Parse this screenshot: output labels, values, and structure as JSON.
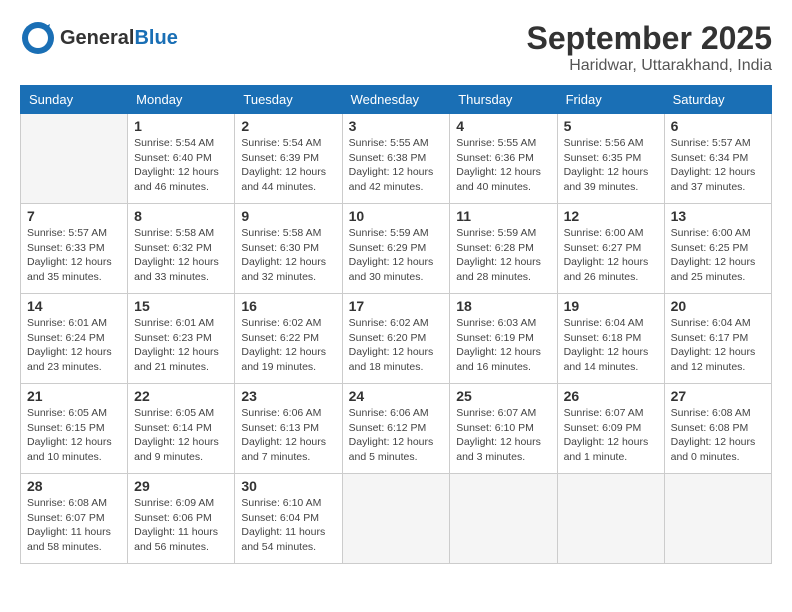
{
  "header": {
    "logo": {
      "general": "General",
      "blue": "Blue"
    },
    "title": "September 2025",
    "subtitle": "Haridwar, Uttarakhand, India"
  },
  "calendar": {
    "days_of_week": [
      "Sunday",
      "Monday",
      "Tuesday",
      "Wednesday",
      "Thursday",
      "Friday",
      "Saturday"
    ],
    "weeks": [
      [
        {
          "day": null,
          "info": null
        },
        {
          "day": "1",
          "info": "Sunrise: 5:54 AM\nSunset: 6:40 PM\nDaylight: 12 hours\nand 46 minutes."
        },
        {
          "day": "2",
          "info": "Sunrise: 5:54 AM\nSunset: 6:39 PM\nDaylight: 12 hours\nand 44 minutes."
        },
        {
          "day": "3",
          "info": "Sunrise: 5:55 AM\nSunset: 6:38 PM\nDaylight: 12 hours\nand 42 minutes."
        },
        {
          "day": "4",
          "info": "Sunrise: 5:55 AM\nSunset: 6:36 PM\nDaylight: 12 hours\nand 40 minutes."
        },
        {
          "day": "5",
          "info": "Sunrise: 5:56 AM\nSunset: 6:35 PM\nDaylight: 12 hours\nand 39 minutes."
        },
        {
          "day": "6",
          "info": "Sunrise: 5:57 AM\nSunset: 6:34 PM\nDaylight: 12 hours\nand 37 minutes."
        }
      ],
      [
        {
          "day": "7",
          "info": "Sunrise: 5:57 AM\nSunset: 6:33 PM\nDaylight: 12 hours\nand 35 minutes."
        },
        {
          "day": "8",
          "info": "Sunrise: 5:58 AM\nSunset: 6:32 PM\nDaylight: 12 hours\nand 33 minutes."
        },
        {
          "day": "9",
          "info": "Sunrise: 5:58 AM\nSunset: 6:30 PM\nDaylight: 12 hours\nand 32 minutes."
        },
        {
          "day": "10",
          "info": "Sunrise: 5:59 AM\nSunset: 6:29 PM\nDaylight: 12 hours\nand 30 minutes."
        },
        {
          "day": "11",
          "info": "Sunrise: 5:59 AM\nSunset: 6:28 PM\nDaylight: 12 hours\nand 28 minutes."
        },
        {
          "day": "12",
          "info": "Sunrise: 6:00 AM\nSunset: 6:27 PM\nDaylight: 12 hours\nand 26 minutes."
        },
        {
          "day": "13",
          "info": "Sunrise: 6:00 AM\nSunset: 6:25 PM\nDaylight: 12 hours\nand 25 minutes."
        }
      ],
      [
        {
          "day": "14",
          "info": "Sunrise: 6:01 AM\nSunset: 6:24 PM\nDaylight: 12 hours\nand 23 minutes."
        },
        {
          "day": "15",
          "info": "Sunrise: 6:01 AM\nSunset: 6:23 PM\nDaylight: 12 hours\nand 21 minutes."
        },
        {
          "day": "16",
          "info": "Sunrise: 6:02 AM\nSunset: 6:22 PM\nDaylight: 12 hours\nand 19 minutes."
        },
        {
          "day": "17",
          "info": "Sunrise: 6:02 AM\nSunset: 6:20 PM\nDaylight: 12 hours\nand 18 minutes."
        },
        {
          "day": "18",
          "info": "Sunrise: 6:03 AM\nSunset: 6:19 PM\nDaylight: 12 hours\nand 16 minutes."
        },
        {
          "day": "19",
          "info": "Sunrise: 6:04 AM\nSunset: 6:18 PM\nDaylight: 12 hours\nand 14 minutes."
        },
        {
          "day": "20",
          "info": "Sunrise: 6:04 AM\nSunset: 6:17 PM\nDaylight: 12 hours\nand 12 minutes."
        }
      ],
      [
        {
          "day": "21",
          "info": "Sunrise: 6:05 AM\nSunset: 6:15 PM\nDaylight: 12 hours\nand 10 minutes."
        },
        {
          "day": "22",
          "info": "Sunrise: 6:05 AM\nSunset: 6:14 PM\nDaylight: 12 hours\nand 9 minutes."
        },
        {
          "day": "23",
          "info": "Sunrise: 6:06 AM\nSunset: 6:13 PM\nDaylight: 12 hours\nand 7 minutes."
        },
        {
          "day": "24",
          "info": "Sunrise: 6:06 AM\nSunset: 6:12 PM\nDaylight: 12 hours\nand 5 minutes."
        },
        {
          "day": "25",
          "info": "Sunrise: 6:07 AM\nSunset: 6:10 PM\nDaylight: 12 hours\nand 3 minutes."
        },
        {
          "day": "26",
          "info": "Sunrise: 6:07 AM\nSunset: 6:09 PM\nDaylight: 12 hours\nand 1 minute."
        },
        {
          "day": "27",
          "info": "Sunrise: 6:08 AM\nSunset: 6:08 PM\nDaylight: 12 hours\nand 0 minutes."
        }
      ],
      [
        {
          "day": "28",
          "info": "Sunrise: 6:08 AM\nSunset: 6:07 PM\nDaylight: 11 hours\nand 58 minutes."
        },
        {
          "day": "29",
          "info": "Sunrise: 6:09 AM\nSunset: 6:06 PM\nDaylight: 11 hours\nand 56 minutes."
        },
        {
          "day": "30",
          "info": "Sunrise: 6:10 AM\nSunset: 6:04 PM\nDaylight: 11 hours\nand 54 minutes."
        },
        {
          "day": null,
          "info": null
        },
        {
          "day": null,
          "info": null
        },
        {
          "day": null,
          "info": null
        },
        {
          "day": null,
          "info": null
        }
      ]
    ]
  }
}
